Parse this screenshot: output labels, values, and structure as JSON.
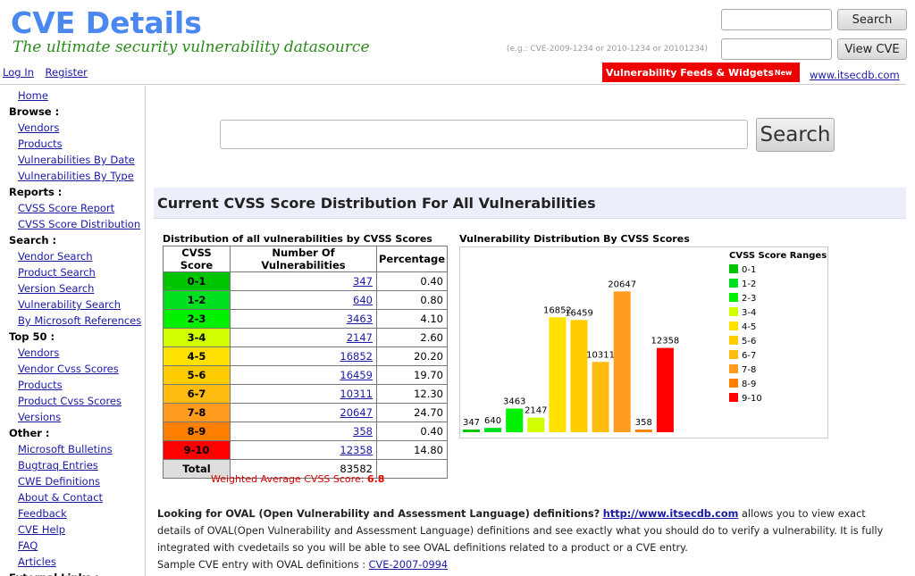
{
  "header": {
    "logo_title": "CVE Details",
    "logo_tagline": "The ultimate security vulnerability datasource",
    "search_button": "Search",
    "view_cve_button": "View CVE",
    "cve_hint": "(e.g.: CVE-2009-1234 or 2010-1234 or 20101234)",
    "login_link": "Log In",
    "register_link": "Register",
    "feeds_label": "Vulnerability Feeds & Widgets",
    "feeds_badge": "New",
    "itsec_link": "www.itsecdb.com"
  },
  "sidebar": {
    "items": [
      {
        "type": "link",
        "label": "Home"
      },
      {
        "type": "head",
        "label": "Browse :"
      },
      {
        "type": "link",
        "label": "Vendors"
      },
      {
        "type": "link",
        "label": "Products"
      },
      {
        "type": "link",
        "label": "Vulnerabilities By Date"
      },
      {
        "type": "link",
        "label": "Vulnerabilities By Type"
      },
      {
        "type": "head",
        "label": "Reports :"
      },
      {
        "type": "link",
        "label": "CVSS Score Report"
      },
      {
        "type": "link",
        "label": "CVSS Score Distribution"
      },
      {
        "type": "head",
        "label": "Search :"
      },
      {
        "type": "link",
        "label": "Vendor Search"
      },
      {
        "type": "link",
        "label": "Product Search"
      },
      {
        "type": "link",
        "label": "Version Search"
      },
      {
        "type": "link",
        "label": "Vulnerability Search"
      },
      {
        "type": "link",
        "label": "By Microsoft References"
      },
      {
        "type": "head",
        "label": "Top 50 :"
      },
      {
        "type": "link",
        "label": "Vendors"
      },
      {
        "type": "link",
        "label": "Vendor Cvss Scores"
      },
      {
        "type": "link",
        "label": "Products"
      },
      {
        "type": "link",
        "label": "Product Cvss Scores"
      },
      {
        "type": "link",
        "label": "Versions"
      },
      {
        "type": "head",
        "label": "Other :"
      },
      {
        "type": "link",
        "label": "Microsoft Bulletins"
      },
      {
        "type": "link",
        "label": "Bugtraq Entries"
      },
      {
        "type": "link",
        "label": "CWE Definitions"
      },
      {
        "type": "link",
        "label": "About & Contact"
      },
      {
        "type": "link",
        "label": "Feedback"
      },
      {
        "type": "link",
        "label": "CVE Help"
      },
      {
        "type": "link",
        "label": "FAQ"
      },
      {
        "type": "link",
        "label": "Articles"
      },
      {
        "type": "head",
        "label": "External Links :"
      }
    ]
  },
  "main": {
    "search_button": "Search",
    "section_title": "Current CVSS Score Distribution For All Vulnerabilities",
    "table_caption": "Distribution of all vulnerabilities by CVSS Scores",
    "table_headers": [
      "CVSS Score",
      "Number Of Vulnerabilities",
      "Percentage"
    ],
    "rows": [
      {
        "score": "0-1",
        "count": "347",
        "pct": "0.40",
        "color": "#00c400"
      },
      {
        "score": "1-2",
        "count": "640",
        "pct": "0.80",
        "color": "#00e020"
      },
      {
        "score": "2-3",
        "count": "3463",
        "pct": "4.10",
        "color": "#00f000"
      },
      {
        "score": "3-4",
        "count": "2147",
        "pct": "2.60",
        "color": "#d1ff00"
      },
      {
        "score": "4-5",
        "count": "16852",
        "pct": "20.20",
        "color": "#ffe000"
      },
      {
        "score": "5-6",
        "count": "16459",
        "pct": "19.70",
        "color": "#ffcc00"
      },
      {
        "score": "6-7",
        "count": "10311",
        "pct": "12.30",
        "color": "#ffbc10"
      },
      {
        "score": "7-8",
        "count": "20647",
        "pct": "24.70",
        "color": "#ff9c20"
      },
      {
        "score": "8-9",
        "count": "358",
        "pct": "0.40",
        "color": "#ff8000"
      },
      {
        "score": "9-10",
        "count": "12358",
        "pct": "14.80",
        "color": "#ff0000"
      }
    ],
    "total_label": "Total",
    "total_value": "83582",
    "weighted_label": "Weighted Average CVSS Score: ",
    "weighted_value": "6.8",
    "chart_caption": "Vulnerability Distribution By CVSS Scores",
    "oval_question": "Looking for OVAL (Open Vulnerability and Assessment Language) definitions?",
    "oval_link": "http://www.itsecdb.com",
    "oval_body": " allows you to view exact details of OVAL(Open Vulnerability and Assessment Language) definitions and see exactly what you should do to verify a vulnerability. It is fully integrated with cvedetails so you will be able to see OVAL definitions related to a product or a CVE entry.",
    "oval_sample_label": "Sample CVE entry with OVAL definitions : ",
    "oval_sample_link": "CVE-2007-0994"
  },
  "chart_data": {
    "type": "bar",
    "categories": [
      "0-1",
      "1-2",
      "2-3",
      "3-4",
      "4-5",
      "5-6",
      "6-7",
      "7-8",
      "8-9",
      "9-10"
    ],
    "values": [
      347,
      640,
      3463,
      2147,
      16852,
      16459,
      10311,
      20647,
      358,
      12358
    ],
    "colors": [
      "#00c400",
      "#00e020",
      "#00f000",
      "#d1ff00",
      "#ffe000",
      "#ffcc00",
      "#ffbc10",
      "#ff9c20",
      "#ff8000",
      "#ff0000"
    ],
    "legend_title": "CVSS Score Ranges",
    "legend_position": "right",
    "ylim": [
      0,
      22000
    ],
    "grid": false
  }
}
